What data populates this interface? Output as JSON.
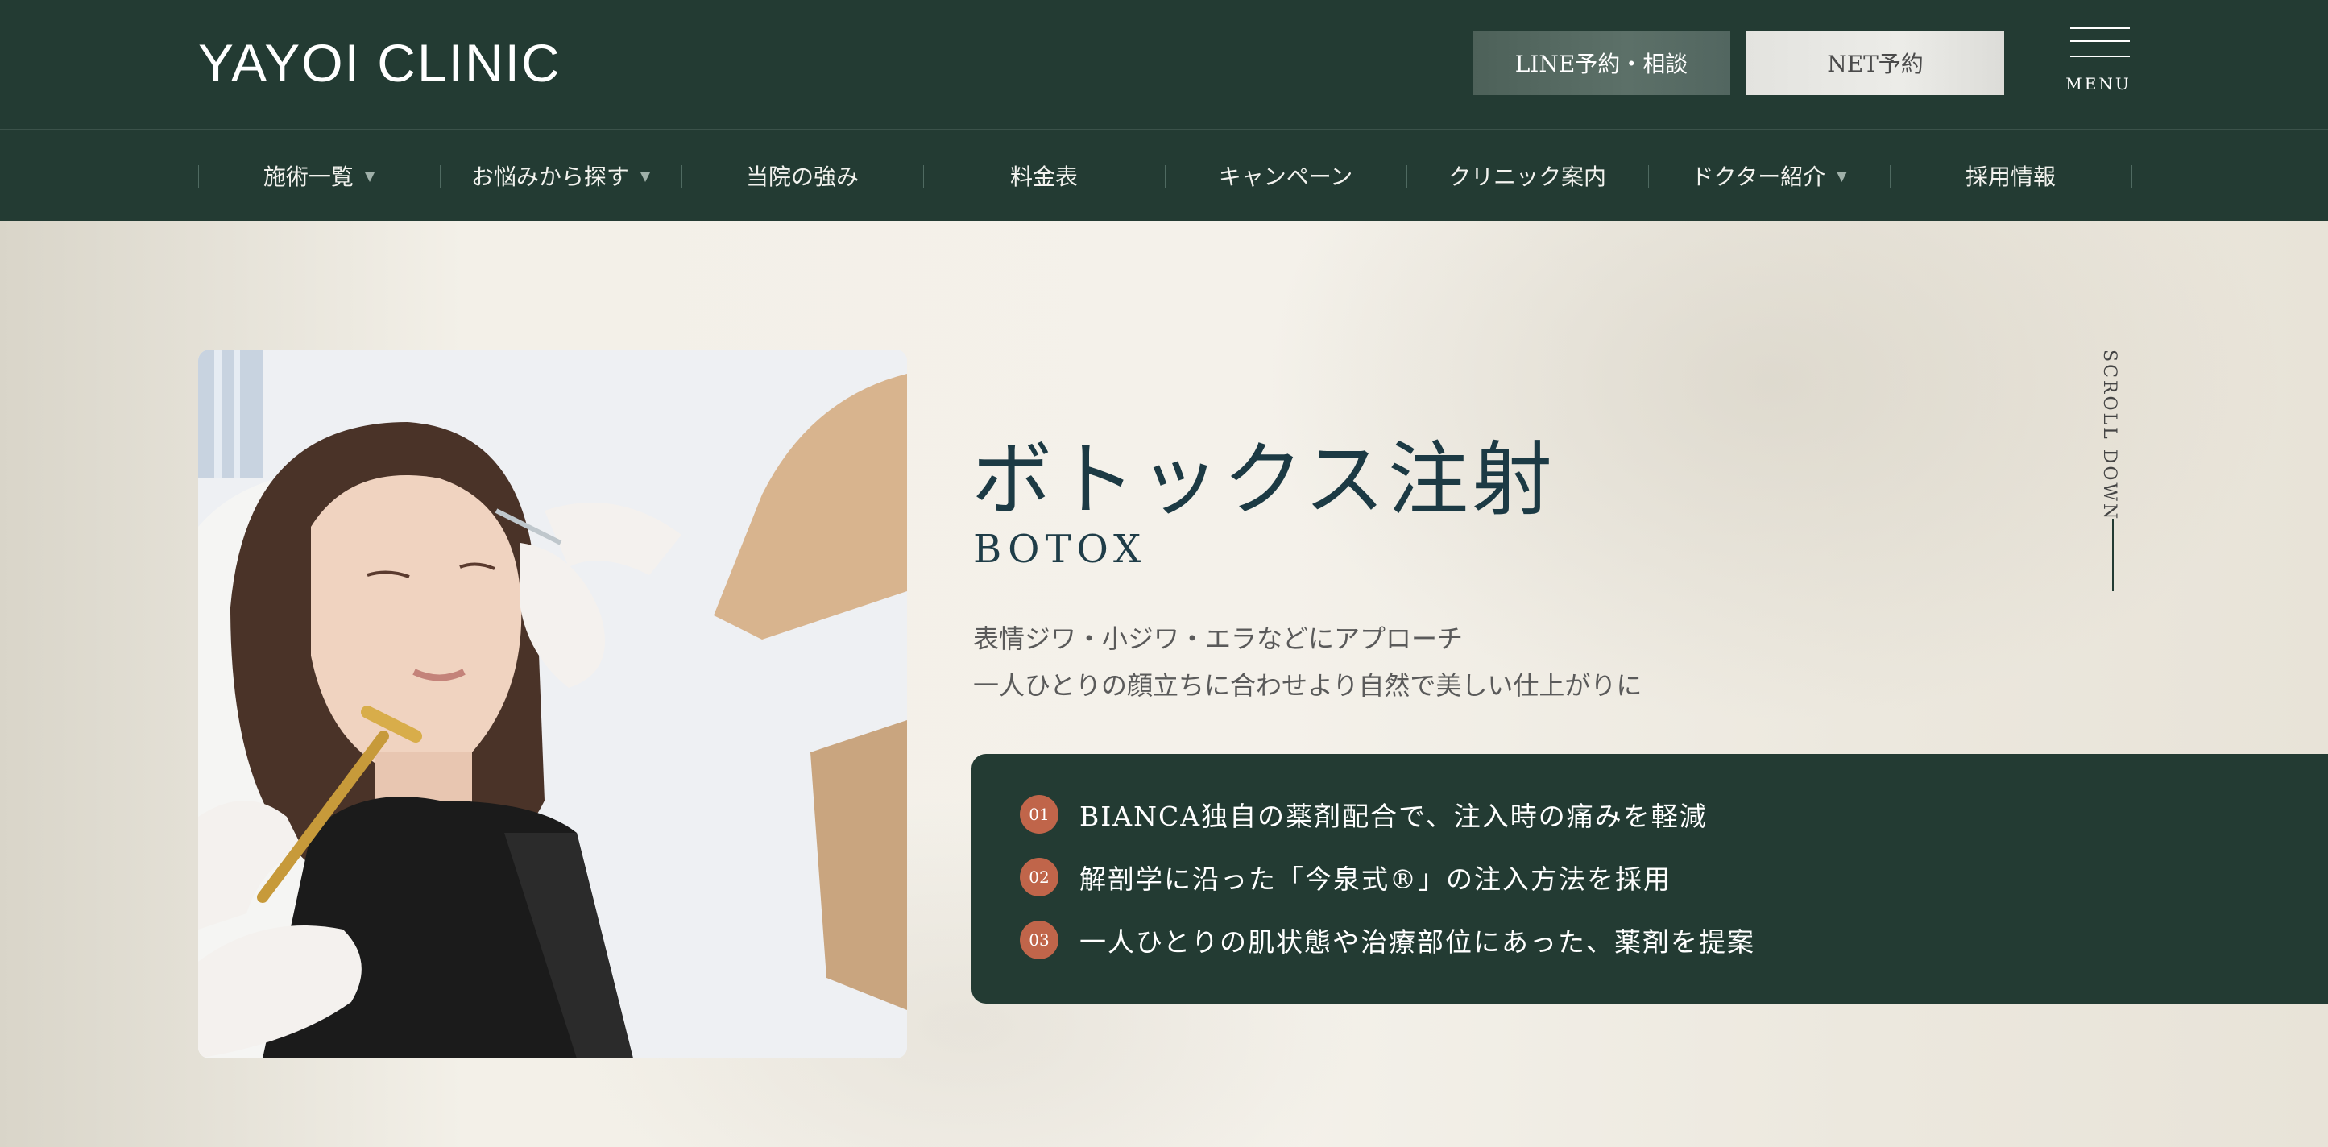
{
  "header": {
    "logo": "YAYOI CLINIC",
    "line_button": "LINE予約・相談",
    "net_button": "NET予約",
    "menu_label": "MENU"
  },
  "nav": {
    "items": [
      {
        "label": "施術一覧",
        "has_dropdown": true
      },
      {
        "label": "お悩みから探す",
        "has_dropdown": true
      },
      {
        "label": "当院の強み",
        "has_dropdown": false
      },
      {
        "label": "料金表",
        "has_dropdown": false
      },
      {
        "label": "キャンペーン",
        "has_dropdown": false
      },
      {
        "label": "クリニック案内",
        "has_dropdown": false
      },
      {
        "label": "ドクター紹介",
        "has_dropdown": true
      },
      {
        "label": "採用情報",
        "has_dropdown": false
      }
    ],
    "caret": "▼"
  },
  "hero": {
    "title": "ボトックス注射",
    "subtitle": "BOTOX",
    "desc_line1": "表情ジワ・小ジワ・エラなどにアプローチ",
    "desc_line2": "一人ひとりの顔立ちに合わせより自然で美しい仕上がりに",
    "features": [
      {
        "num": "01",
        "text": "BIANCA独自の薬剤配合で、注入時の痛みを軽減"
      },
      {
        "num": "02",
        "text": "解剖学に沿った「今泉式®」の注入方法を採用"
      },
      {
        "num": "03",
        "text": "一人ひとりの肌状態や治療部位にあった、薬剤を提案"
      }
    ],
    "scroll_label": "SCROLL DOWN"
  },
  "colors": {
    "header_bg": "#233b33",
    "accent": "#c0654a",
    "title": "#1c3a44"
  }
}
